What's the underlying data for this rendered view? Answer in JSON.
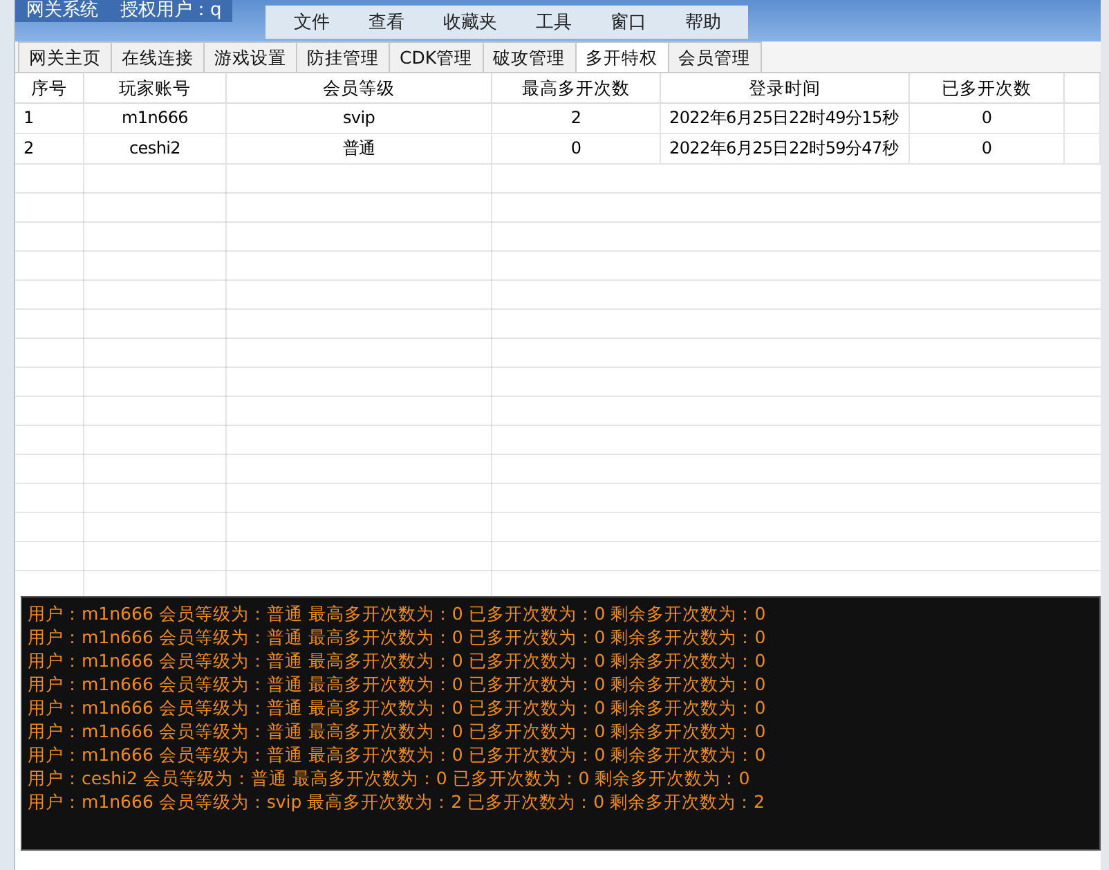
{
  "window": {
    "title": "网关系统",
    "license": "授权用户：q"
  },
  "menu": [
    "文件",
    "查看",
    "收藏夹",
    "工具",
    "窗口",
    "帮助"
  ],
  "tabs": [
    {
      "label": "网关主页",
      "selected": false
    },
    {
      "label": "在线连接",
      "selected": false
    },
    {
      "label": "游戏设置",
      "selected": false
    },
    {
      "label": "防挂管理",
      "selected": false
    },
    {
      "label": "CDK管理",
      "selected": false
    },
    {
      "label": "破攻管理",
      "selected": false
    },
    {
      "label": "多开特权",
      "selected": true
    },
    {
      "label": "会员管理",
      "selected": false
    }
  ],
  "table": {
    "columns": [
      "序号",
      "玩家账号",
      "会员等级",
      "最高多开次数",
      "登录时间",
      "已多开次数"
    ],
    "rows": [
      [
        "1",
        "m1n666",
        "svip",
        "2",
        "2022年6月25日22时49分15秒",
        "0"
      ],
      [
        "2",
        "ceshi2",
        "普通",
        "0",
        "2022年6月25日22时59分47秒",
        "0"
      ]
    ]
  },
  "log": [
    "用户：m1n666 会员等级为：普通 最高多开次数为：0 已多开次数为：0 剩余多开次数为：0",
    "用户：m1n666 会员等级为：普通 最高多开次数为：0 已多开次数为：0 剩余多开次数为：0",
    "用户：m1n666 会员等级为：普通 最高多开次数为：0 已多开次数为：0 剩余多开次数为：0",
    "用户：m1n666 会员等级为：普通 最高多开次数为：0 已多开次数为：0 剩余多开次数为：0",
    "用户：m1n666 会员等级为：普通 最高多开次数为：0 已多开次数为：0 剩余多开次数为：0",
    "用户：m1n666 会员等级为：普通 最高多开次数为：0 已多开次数为：0 剩余多开次数为：0",
    "用户：m1n666 会员等级为：普通 最高多开次数为：0 已多开次数为：0 剩余多开次数为：0",
    "用户：ceshi2 会员等级为：普通 最高多开次数为：0 已多开次数为：0 剩余多开次数为：0",
    "用户：m1n666 会员等级为：svip 最高多开次数为：2 已多开次数为：0 剩余多开次数为：2"
  ]
}
